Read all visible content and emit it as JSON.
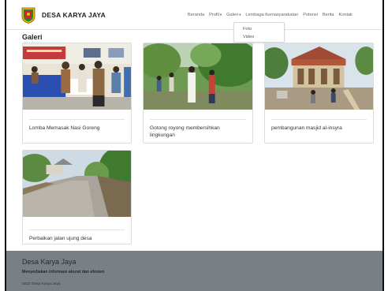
{
  "header": {
    "brand": "DESA KARYA JAYA",
    "nav": [
      {
        "label": "Beranda",
        "has_caret": false
      },
      {
        "label": "Profil",
        "has_caret": true
      },
      {
        "label": "Galeri",
        "has_caret": true
      },
      {
        "label": "Lembaga Kemasyarakatan",
        "has_caret": false
      },
      {
        "label": "Potensi",
        "has_caret": false
      },
      {
        "label": "Berita",
        "has_caret": false
      },
      {
        "label": "Kontak",
        "has_caret": false
      }
    ],
    "caret": "▾"
  },
  "dropdown": {
    "items": [
      "Foto",
      "Video"
    ]
  },
  "page": {
    "title": "Galeri"
  },
  "gallery": [
    {
      "caption": "Lomba Memasak Nasi Goreng"
    },
    {
      "caption": "Gotong royong membersihkan lingkungan"
    },
    {
      "caption": "pembangunan masjid al-insyra"
    },
    {
      "caption": "Perbaikan jalan ujung desa"
    }
  ],
  "footer": {
    "title": "Desa Karya Jaya",
    "tagline": "Menyediakan informasi akurat dan efesien",
    "copyright": "2023 Desa Karya Jaya"
  },
  "colors": {
    "footer_bg": "#7a7f84",
    "logo_red": "#c62828",
    "logo_gold": "#f2b705",
    "logo_green": "#2e7d32"
  }
}
